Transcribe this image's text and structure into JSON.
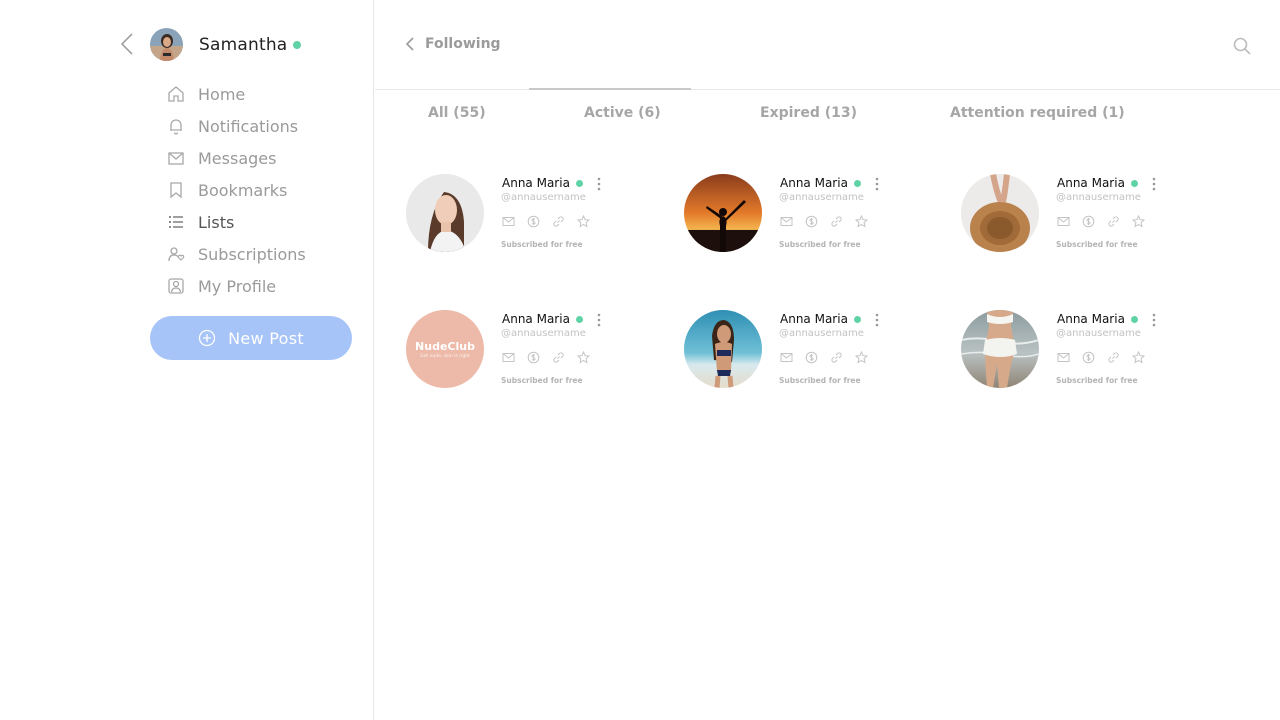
{
  "sidebar": {
    "user_name": "Samantha",
    "nav": [
      {
        "label": "Home",
        "icon": "home-icon"
      },
      {
        "label": "Notifications",
        "icon": "bell-icon"
      },
      {
        "label": "Messages",
        "icon": "mail-icon"
      },
      {
        "label": "Bookmarks",
        "icon": "bookmark-icon"
      },
      {
        "label": "Lists",
        "icon": "list-icon"
      },
      {
        "label": "Subscriptions",
        "icon": "user-heart-icon"
      },
      {
        "label": "My Profile",
        "icon": "profile-icon"
      }
    ],
    "new_post_label": "New Post"
  },
  "header": {
    "title": "Following"
  },
  "tabs": [
    {
      "label": "All (55)"
    },
    {
      "label": "Active (6)"
    },
    {
      "label": "Expired (13)"
    },
    {
      "label": "Attention required (1)"
    }
  ],
  "cards": [
    {
      "name": "Anna Maria",
      "handle": "@annausername",
      "status": "Subscribed for free"
    },
    {
      "name": "Anna Maria",
      "handle": "@annausername",
      "status": "Subscribed for free"
    },
    {
      "name": "Anna Maria",
      "handle": "@annausername",
      "status": "Subscribed for free"
    },
    {
      "name": "Anna Maria",
      "handle": "@annausername",
      "status": "Subscribed for free",
      "brand_name": "NudeClub",
      "brand_tagline": "Get nude, skin is right"
    },
    {
      "name": "Anna Maria",
      "handle": "@annausername",
      "status": "Subscribed for free"
    },
    {
      "name": "Anna Maria",
      "handle": "@annausername",
      "status": "Subscribed for free"
    }
  ],
  "colors": {
    "accent": "#a7c4f8",
    "online": "#5fd3a6",
    "brand_bg": "#edb9a8"
  }
}
